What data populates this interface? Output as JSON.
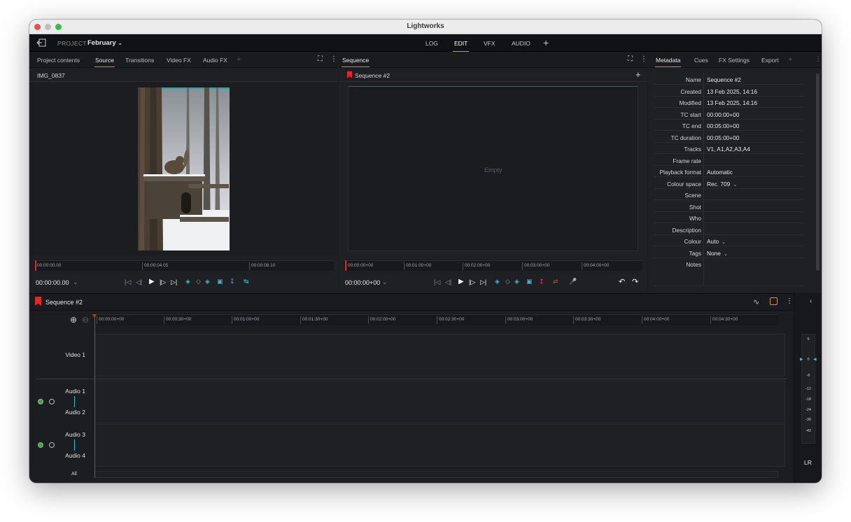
{
  "window": {
    "title": "Lightworks"
  },
  "appbar": {
    "project_label": "PROJECT",
    "project_name": "February",
    "modes": [
      "LOG",
      "EDIT",
      "VFX",
      "AUDIO"
    ],
    "active_mode": "EDIT",
    "add_symbol": "+"
  },
  "source_panel": {
    "tabs": [
      "Project contents",
      "Source",
      "Transitions",
      "Video FX",
      "Audio FX"
    ],
    "active_tab": "Source",
    "clip_name": "IMG_0837",
    "ruler_ticks": [
      "00:00:00.00",
      "00:00:04.05",
      "00:00:08.10"
    ],
    "timecode": "00:00:00.00"
  },
  "sequence_panel": {
    "title": "Sequence",
    "sequence_name": "Sequence #2",
    "empty_label": "Empty",
    "ruler_ticks": [
      "00:00:00+00",
      "00:01:00+00",
      "00:02:00+00",
      "00:03:00+00",
      "00:04:00+00"
    ],
    "timecode": "00:00:00+00"
  },
  "metadata_panel": {
    "tabs": [
      "Metadata",
      "Cues",
      "FX Settings",
      "Export"
    ],
    "active_tab": "Metadata",
    "rows": [
      {
        "key": "Name",
        "value": "Sequence #2"
      },
      {
        "key": "Created",
        "value": "13 Feb 2025, 14:16"
      },
      {
        "key": "Modified",
        "value": "13 Feb 2025, 14:16"
      },
      {
        "key": "TC start",
        "value": "00:00:00+00"
      },
      {
        "key": "TC end",
        "value": "00:05:00+00"
      },
      {
        "key": "TC duration",
        "value": "00:05:00+00"
      },
      {
        "key": "Tracks",
        "value": "V1, A1,A2,A3,A4"
      },
      {
        "key": "Frame rate",
        "value": ""
      },
      {
        "key": "Playback format",
        "value": "Automatic"
      },
      {
        "key": "Colour space",
        "value": "Rec. 709"
      },
      {
        "key": "Scene",
        "value": ""
      },
      {
        "key": "Shot",
        "value": ""
      },
      {
        "key": "Who",
        "value": ""
      },
      {
        "key": "Description",
        "value": ""
      },
      {
        "key": "Colour",
        "value": "Auto"
      },
      {
        "key": "Tags",
        "value": "None"
      },
      {
        "key": "Notes",
        "value": ""
      }
    ]
  },
  "timeline": {
    "sequence_name": "Sequence #2",
    "ruler_ticks": [
      "00:00:00+00",
      "00:00:30+00",
      "00:01:00+00",
      "00:01:30+00",
      "00:02:00+00",
      "00:02:30+00",
      "00:03:00+00",
      "00:03:30+00",
      "00:04:00+00",
      "00:04:30+00"
    ],
    "tracks": {
      "video1": "Video 1",
      "audio1": "Audio 1",
      "audio2": "Audio 2",
      "audio3": "Audio 3",
      "audio4": "Audio 4",
      "all": "All"
    }
  },
  "meter": {
    "scale": [
      "6",
      "0",
      "-6",
      "-12",
      "-18",
      "-24",
      "-30",
      "-42"
    ],
    "channels_label": "LR"
  },
  "colors": {
    "accent": "#c99358",
    "playhead": "#e0282a",
    "cyan": "#3fb5d6",
    "active_green": "#4e9e4b"
  }
}
